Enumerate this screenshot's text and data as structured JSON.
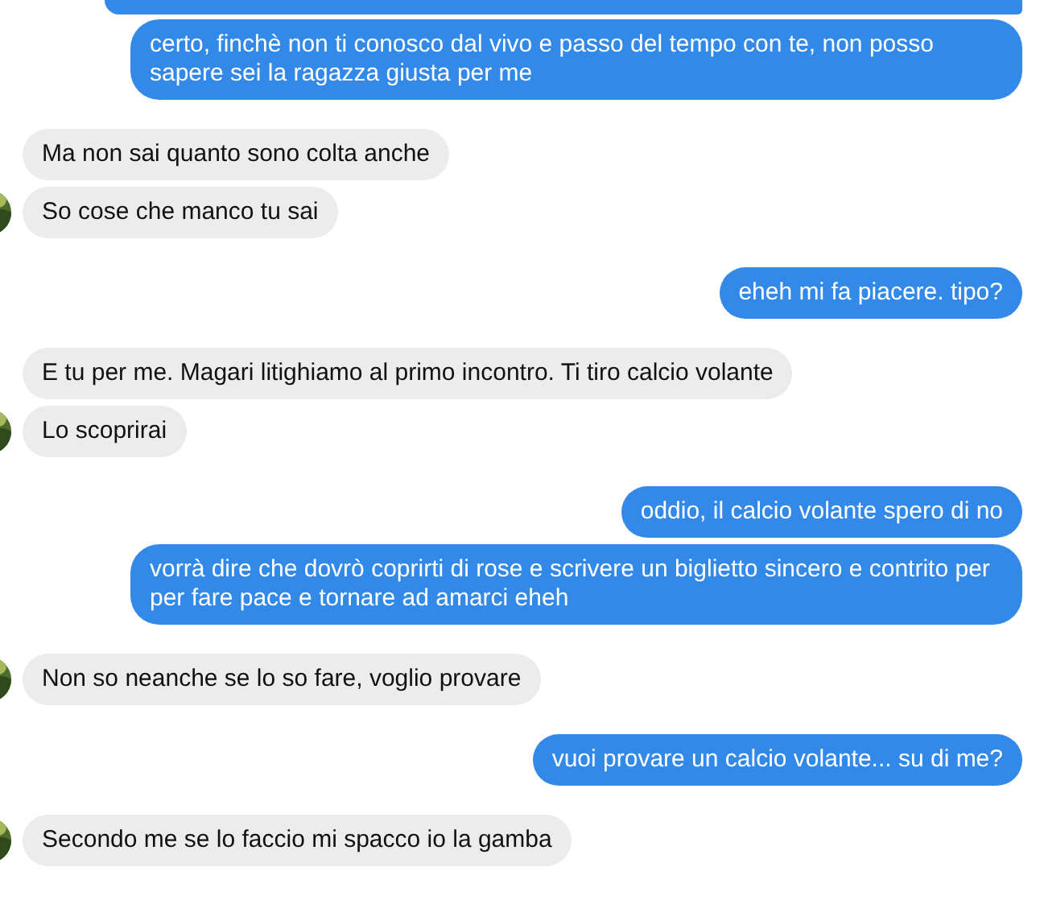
{
  "groups": [
    {
      "kind": "sent",
      "messages": [
        "certo, finchè non ti conosco dal vivo e passo del tempo con te, non posso sapere sei la ragazza giusta per me"
      ]
    },
    {
      "kind": "received",
      "messages": [
        "Ma non sai quanto sono colta anche",
        "So cose che manco tu sai"
      ]
    },
    {
      "kind": "sent",
      "messages": [
        "eheh mi fa piacere. tipo?"
      ]
    },
    {
      "kind": "received",
      "messages": [
        "E tu per me. Magari litighiamo al primo incontro. Ti tiro calcio volante",
        "Lo scoprirai"
      ]
    },
    {
      "kind": "sent",
      "messages": [
        "oddio, il calcio volante spero di no",
        "vorrà dire che dovrò coprirti di rose e scrivere un biglietto sincero e contrito per per fare pace e tornare ad amarci eheh"
      ]
    },
    {
      "kind": "received",
      "messages": [
        "Non so neanche se lo so fare, voglio provare"
      ]
    },
    {
      "kind": "sent",
      "messages": [
        "vuoi provare un calcio volante... su di me?"
      ]
    },
    {
      "kind": "received",
      "messages": [
        "Secondo me se lo faccio mi spacco io la gamba"
      ]
    }
  ]
}
